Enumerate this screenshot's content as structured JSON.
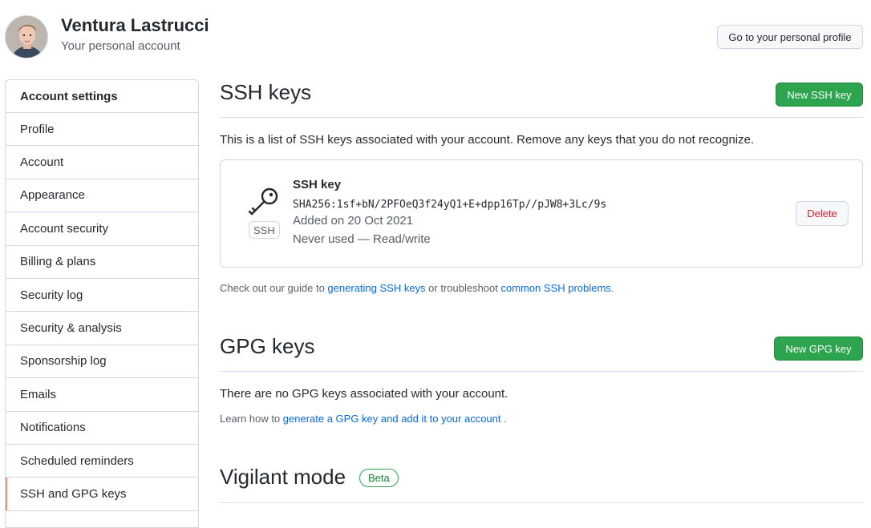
{
  "user": {
    "name": "Ventura Lastrucci",
    "subtitle": "Your personal account",
    "profile_button": "Go to your personal profile"
  },
  "sidebar": {
    "heading": "Account settings",
    "items": [
      {
        "label": "Profile"
      },
      {
        "label": "Account"
      },
      {
        "label": "Appearance"
      },
      {
        "label": "Account security"
      },
      {
        "label": "Billing & plans"
      },
      {
        "label": "Security log"
      },
      {
        "label": "Security & analysis"
      },
      {
        "label": "Sponsorship log"
      },
      {
        "label": "Emails"
      },
      {
        "label": "Notifications"
      },
      {
        "label": "Scheduled reminders"
      },
      {
        "label": "SSH and GPG keys",
        "selected": true
      }
    ]
  },
  "ssh": {
    "title": "SSH keys",
    "new_button": "New SSH key",
    "description": "This is a list of SSH keys associated with your account. Remove any keys that you do not recognize.",
    "key": {
      "badge": "SSH",
      "title": "SSH key",
      "fingerprint": "SHA256:1sf+bN/2PFOeQ3f24yQ1+E+dpp16Tp//pJW8+3Lc/9s",
      "added": "Added on 20 Oct 2021",
      "usage": "Never used — Read/write",
      "delete_button": "Delete"
    },
    "guide": {
      "prefix": "Check out our guide to ",
      "link1": "generating SSH keys",
      "middle": " or troubleshoot ",
      "link2": "common SSH problems",
      "suffix": "."
    }
  },
  "gpg": {
    "title": "GPG keys",
    "new_button": "New GPG key",
    "empty_text": "There are no GPG keys associated with your account.",
    "learn": {
      "prefix": "Learn how to ",
      "link": "generate a GPG key and add it to your account",
      "suffix": " ."
    }
  },
  "vigilant": {
    "title": "Vigilant mode",
    "badge": "Beta"
  },
  "colors": {
    "primary_green": "#2da44e",
    "link_blue": "#0969da",
    "danger_red": "#cf222e",
    "selected_accent": "#fd8c73",
    "border": "#d0d7de"
  }
}
